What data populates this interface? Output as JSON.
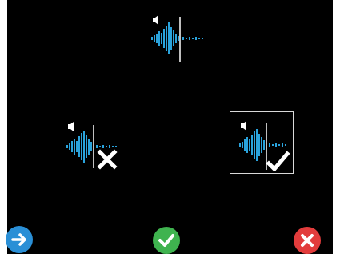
{
  "colors": {
    "background": "#000000",
    "page": "#ffffff",
    "waveform": "#2aa3dc",
    "marker": "#ffffff",
    "selection_border": "#d8d8d8",
    "next_button": "#2a8fd6",
    "confirm_button": "#3fb34f",
    "cancel_button": "#e23c3c"
  },
  "options": [
    {
      "icon": "audio-waveform-icon",
      "state": "none",
      "selected": false
    },
    {
      "icon": "audio-waveform-icon",
      "state": "incorrect",
      "marker_icon": "x-mark-icon",
      "selected": false
    },
    {
      "icon": "audio-waveform-icon",
      "state": "correct",
      "marker_icon": "check-mark-icon",
      "selected": true
    }
  ],
  "controls": {
    "next": {
      "icon": "arrow-right-icon"
    },
    "confirm": {
      "icon": "check-icon"
    },
    "cancel": {
      "icon": "close-icon"
    }
  }
}
